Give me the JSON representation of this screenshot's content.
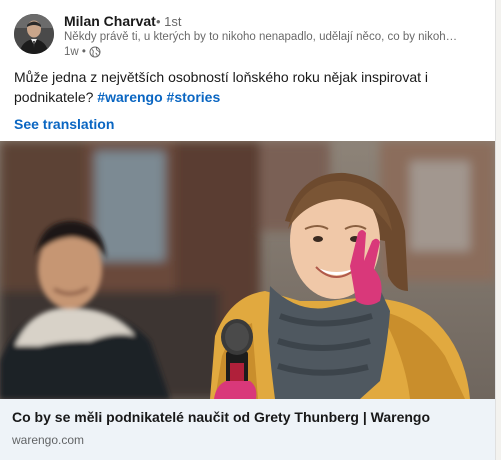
{
  "post": {
    "author_name": "Milan Charvat",
    "degree": "• 1st",
    "headline": "Někdy právě ti, u kterých by to nikoho nenapadlo, udělají něco, co by nikoh…",
    "time": "1w •",
    "text_main": "Může jedna z největších osobností loňského roku nějak inspirovat i podnikatele? ",
    "hashtag_1": "#warengo",
    "hashtag_2": "#stories",
    "see_translation": "See translation",
    "visibility_icon": "globe-icon"
  },
  "link_preview": {
    "title": "Co by se měli podnikatelé naučit od Grety Thunberg | Warengo",
    "domain": "warengo.com"
  },
  "colors": {
    "link_blue": "#0a66c2",
    "footer_bg": "#eef3f8"
  }
}
